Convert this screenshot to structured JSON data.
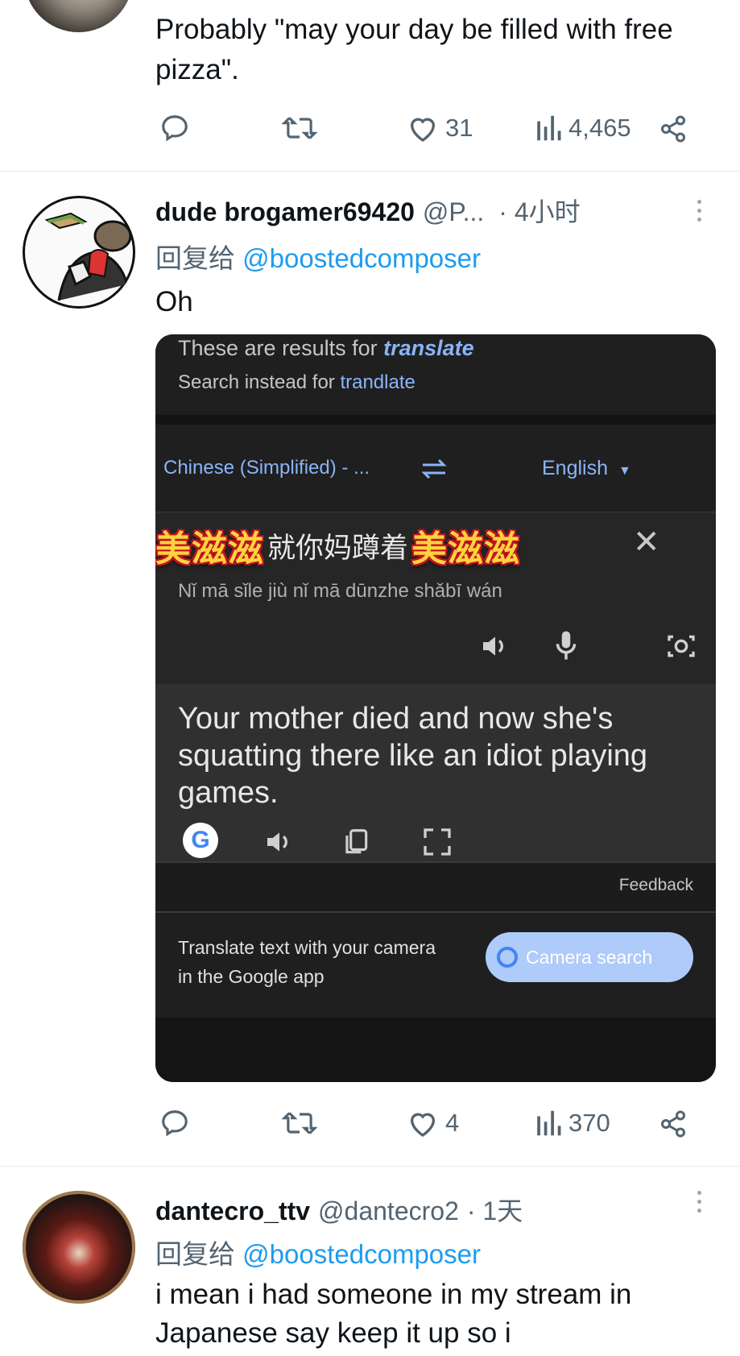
{
  "tweet1": {
    "text": "Probably \"may your day be filled with free pizza\".",
    "likes": "31",
    "views": "4,465"
  },
  "tweet2": {
    "name": "dude brogamer69420",
    "handle": "@P...",
    "time": "· 4小时",
    "reply_prefix": "回复给",
    "reply_to": "@boostedcomposer",
    "text": "Oh",
    "likes": "4",
    "views": "370",
    "attachment": {
      "results_for_prefix": "These are results for",
      "results_for_term": "translate",
      "search_instead_prefix": "Search instead for",
      "search_instead_term": "trandlate",
      "source_lang": "Chinese (Simplified) - ...",
      "target_lang": "English",
      "overlay_word": "美滋滋",
      "source_text": "就你妈蹲着",
      "pinyin": "Nǐ mā sǐle jiù nǐ mā dūnzhe shǎbī wán",
      "translation": "Your mother died and now she's squatting there like an idiot playing games.",
      "feedback": "Feedback",
      "camera_promo_line1": "Translate text with your camera",
      "camera_promo_line2": "in the Google app",
      "camera_button": "Camera search"
    }
  },
  "tweet3": {
    "name": "dantecro_ttv",
    "handle": "@dantecro2",
    "time": "· 1天",
    "reply_prefix": "回复给",
    "reply_to": "@boostedcomposer",
    "text_line1": "i mean i had someone in my stream in",
    "text_line2": "Japanese say keep it up so i"
  },
  "colors": {
    "link": "#1d9bf0",
    "secondary": "#536471",
    "card_bg": "#1f1f1f",
    "google_blue": "#8ab4f8"
  }
}
